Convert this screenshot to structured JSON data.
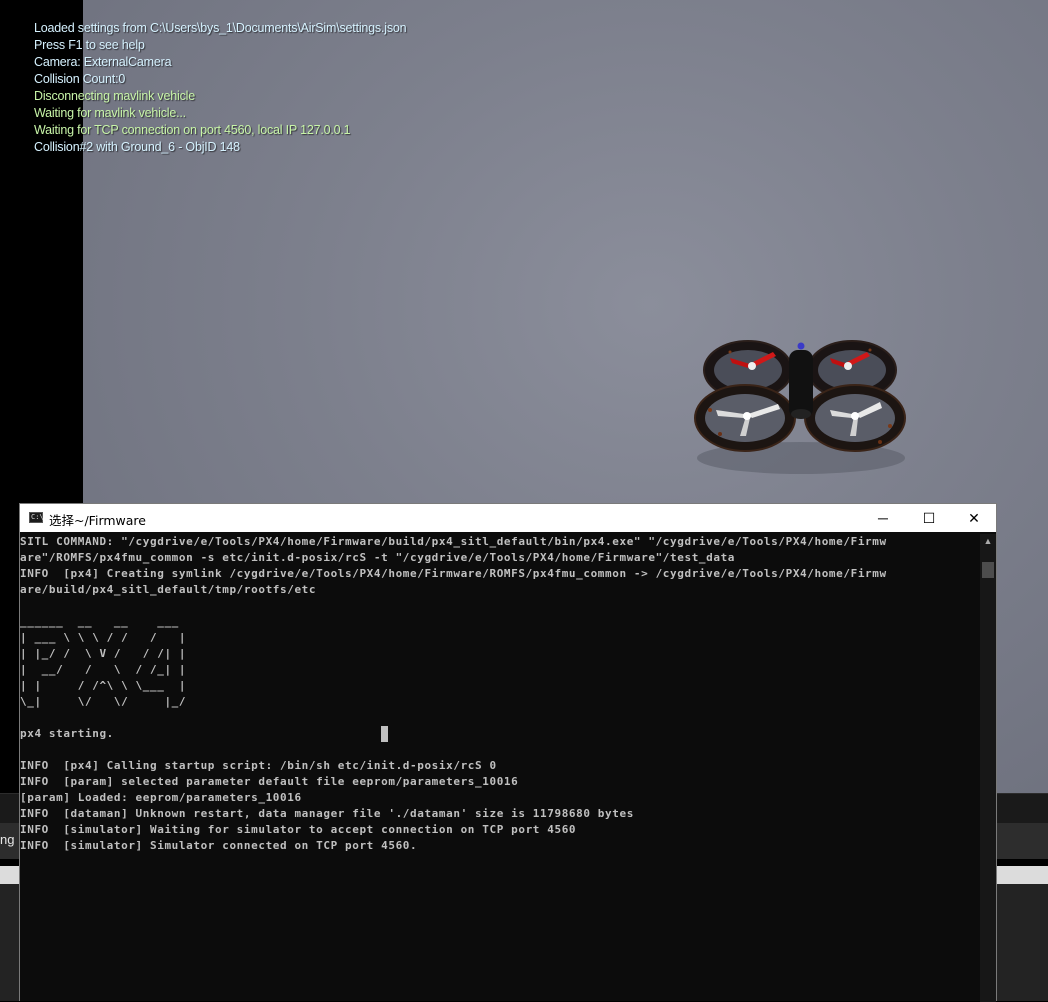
{
  "overlay": {
    "lines": [
      {
        "text": "Loaded settings from C:\\Users\\bys_1\\Documents\\AirSim\\settings.json",
        "color": "#d6f2ff"
      },
      {
        "text": "Press F1 to see help",
        "color": "#d6f2ff"
      },
      {
        "text": "Camera: ExternalCamera",
        "color": "#d6f2ff"
      },
      {
        "text": "Collision Count:0",
        "color": "#d6f2ff"
      },
      {
        "text": "Disconnecting mavlink vehicle",
        "color": "#c8f5a8"
      },
      {
        "text": "Waiting for mavlink vehicle...",
        "color": "#c8f5a8"
      },
      {
        "text": "Waiting for TCP connection on port 4560, local IP 127.0.0.1",
        "color": "#c8f5a8"
      },
      {
        "text": "Collision#2 with Ground_6 - ObjID 148",
        "color": "#d6f2ff"
      }
    ]
  },
  "editor": {
    "edge_text": "ng"
  },
  "terminal": {
    "icon_label": "C:\\",
    "title": "选择~/Firmware",
    "minimize_glyph": "─",
    "maximize_glyph": "☐",
    "close_glyph": "✕",
    "scroll_up_glyph": "▲",
    "lines": [
      "SITL COMMAND: \"/cygdrive/e/Tools/PX4/home/Firmware/build/px4_sitl_default/bin/px4.exe\" \"/cygdrive/e/Tools/PX4/home/Firmw",
      "are\"/ROMFS/px4fmu_common -s etc/init.d-posix/rcS -t \"/cygdrive/e/Tools/PX4/home/Firmware\"/test_data",
      "INFO  [px4] Creating symlink /cygdrive/e/Tools/PX4/home/Firmware/ROMFS/px4fmu_common -> /cygdrive/e/Tools/PX4/home/Firmw",
      "are/build/px4_sitl_default/tmp/rootfs/etc",
      "",
      "______  __   __    ___",
      "| ___ \\ \\ \\ / /   /   |",
      "| |_/ /  \\ V /   / /| |",
      "|  __/   /   \\  / /_| |",
      "| |     / /^\\ \\ \\___  |",
      "\\_|     \\/   \\/     |_/",
      "",
      "px4 starting.",
      "",
      "INFO  [px4] Calling startup script: /bin/sh etc/init.d-posix/rcS 0",
      "INFO  [param] selected parameter default file eeprom/parameters_10016",
      "[param] Loaded: eeprom/parameters_10016",
      "INFO  [dataman] Unknown restart, data manager file './dataman' size is 11798680 bytes",
      "INFO  [simulator] Waiting for simulator to accept connection on TCP port 4560",
      "INFO  [simulator] Simulator connected on TCP port 4560."
    ]
  }
}
